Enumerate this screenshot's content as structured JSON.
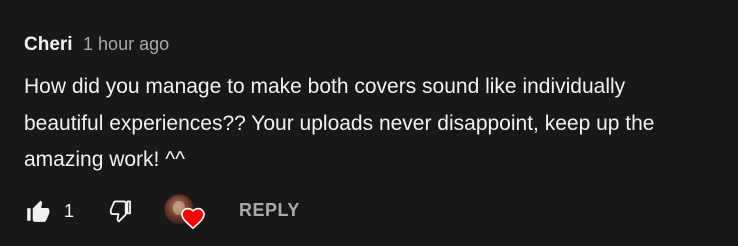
{
  "comment": {
    "author": "Cheri",
    "timestamp": "1 hour ago",
    "text_lines": [
      "How did you manage to make both covers sound like individually",
      "beautiful experiences?? Your uploads never disappoint, keep up the",
      "amazing work! ^^"
    ]
  },
  "actions": {
    "like_icon": "thumbs-up-icon",
    "like_count": "1",
    "dislike_icon": "thumbs-down-icon",
    "creator_heart_icon": "creator-heart-icon",
    "reply_label": "REPLY"
  },
  "colors": {
    "background": "#181818",
    "primary_text": "#f1f1f1",
    "secondary_text": "#aaaaaa",
    "heart": "#ff0000"
  }
}
